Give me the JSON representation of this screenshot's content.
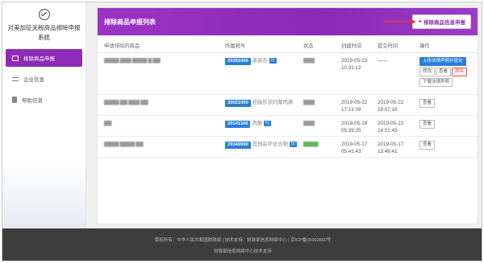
{
  "sidebar": {
    "brand_title": "对美加征关税商品排除申报系统",
    "items": [
      {
        "label": "排除商品申报",
        "active": true,
        "icon": "form-icon"
      },
      {
        "label": "企业信息",
        "active": false,
        "icon": "sliders-icon"
      },
      {
        "label": "帮助信息",
        "active": false,
        "icon": "document-icon"
      }
    ]
  },
  "panel": {
    "title": "排除商品申报列表",
    "add_button_label": "排除商品信息申报",
    "columns": [
      "申请排除的商品",
      "所属税号",
      "状态",
      "创建时间",
      "提交时间",
      "操作"
    ],
    "rows": [
      {
        "product": "▇▇▇▇ ▇▇▇ ▇▇▇▇ ▇ ▇▇",
        "code": "29281000",
        "code_name": "苯肼及",
        "tag": "衍",
        "status": "▇▇▇",
        "created_date": "2019-05-23",
        "created_time": "10:31:12",
        "submitted_date": "——",
        "submitted_time": "",
        "actions": {
          "upload": "上传法律声明并提交",
          "edit": "修改",
          "view": "查看",
          "delete": "删除",
          "download": "下载法律声明"
        }
      },
      {
        "product": "▇▇▇▇ ▇▇ ▇▇▇ ▇▇",
        "code": "39021000",
        "code_name": "初级形状的聚丙烯",
        "tag": "",
        "status": "▇▇▇",
        "created_date": "2019-05-22",
        "created_time": "17:13:09",
        "submitted_date": "2019-05-22",
        "submitted_time": "18:07:16",
        "view": "查看"
      },
      {
        "product": "▇▇",
        "code": "29141100",
        "code_name": "丙酮",
        "tag": "衍",
        "status": "▇▇▇",
        "created_date": "2019-05-18",
        "created_time": "05:39:25",
        "submitted_date": "2019-05-22",
        "submitted_time": "14:01:45",
        "view": "查看"
      },
      {
        "product": "▇▇▇▇ ▇▇▇▇ ▇▇",
        "code": "29349990",
        "code_name": "其他杂环化合物",
        "tag": "衍",
        "status": "▇▇▇▇",
        "created_date": "2019-05-17",
        "created_time": "05:41:43",
        "submitted_date": "2019-05-17",
        "submitted_time": "13:49:41",
        "view": "查看"
      }
    ]
  },
  "footer": {
    "line1": "版权所有：中华人民共和国财政部 | 技术支持：财政部信息网络中心 | 京ICP备05002860号",
    "line2": "财政部信息网络中心技术支持"
  },
  "colors": {
    "accent": "#8a2ab7",
    "code_chip": "#2a7fd8",
    "danger": "#d9534f",
    "footer": "#3d3d3d"
  }
}
